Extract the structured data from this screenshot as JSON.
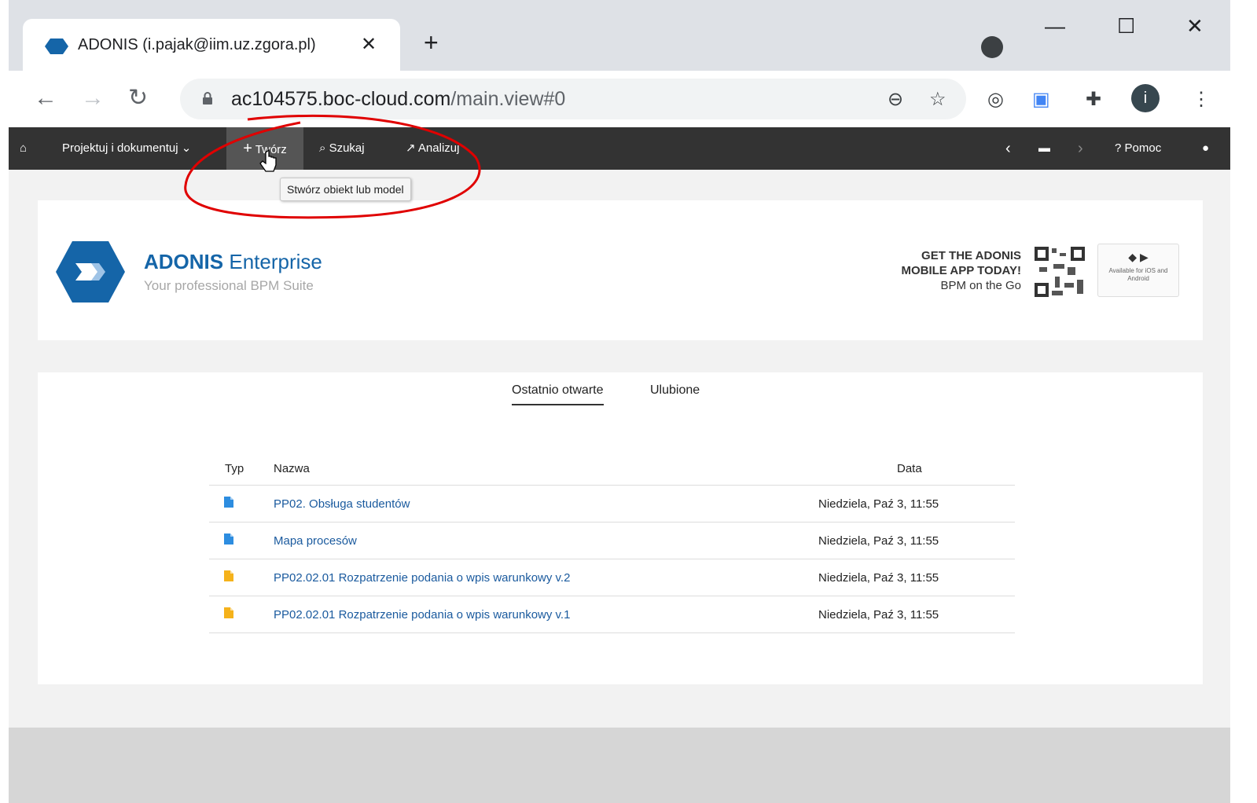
{
  "browser": {
    "tab_title": "ADONIS (i.pajak@iim.uz.zgora.pl)",
    "tab_close": "✕",
    "new_tab": "+",
    "url_host": "ac104575.boc-cloud.com",
    "url_path": "/main.view#0",
    "min": "—",
    "max": "☐",
    "close": "✕",
    "profile_initial": "i"
  },
  "appnav": {
    "projektuj": "Projektuj i dokumentuj",
    "tworz": "Twórz",
    "szukaj": "Szukaj",
    "analizuj": "Analizuj",
    "pomoc": "Pomoc",
    "tooltip": "Stwórz obiekt lub model"
  },
  "banner": {
    "brand_bold": "ADONIS",
    "brand_rest": " Enterprise",
    "subtitle": "Your professional BPM Suite",
    "promo_line1": "GET THE ADONIS",
    "promo_line2": "MOBILE APP TODAY!",
    "promo_line3": "BPM on the Go",
    "store_text": "Available for iOS and Android"
  },
  "recent": {
    "tab_recent": "Ostatnio otwarte",
    "tab_favorites": "Ulubione",
    "col_type": "Typ",
    "col_name": "Nazwa",
    "col_date": "Data",
    "rows": [
      {
        "type": "model-blue",
        "name": "PP02. Obsługa studentów",
        "date": "Niedziela, Paź 3, 11:55"
      },
      {
        "type": "model-blue",
        "name": "Mapa procesów",
        "date": "Niedziela, Paź 3, 11:55"
      },
      {
        "type": "model-orange",
        "name": "PP02.02.01 Rozpatrzenie podania o wpis warunkowy v.2",
        "date": "Niedziela, Paź 3, 11:55"
      },
      {
        "type": "model-orange",
        "name": "PP02.02.01 Rozpatrzenie podania o wpis warunkowy v.1",
        "date": "Niedziela, Paź 3, 11:55"
      }
    ]
  },
  "colors": {
    "nav_bg": "#333333",
    "brand_blue": "#1565a8",
    "annotation_red": "#e00000"
  }
}
